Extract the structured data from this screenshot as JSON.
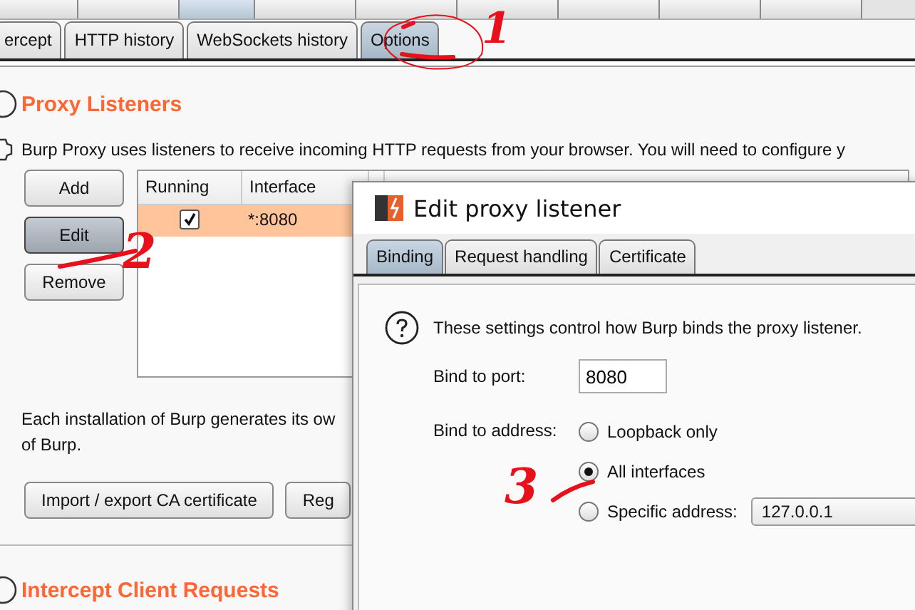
{
  "top_tabs": [
    {
      "selected": false
    },
    {
      "selected": false
    },
    {
      "selected": true
    },
    {
      "selected": false
    },
    {
      "selected": false
    },
    {
      "selected": false
    },
    {
      "selected": false
    },
    {
      "selected": false
    },
    {
      "selected": false
    }
  ],
  "sub_tabs": [
    {
      "label": "ercept",
      "selected": false
    },
    {
      "label": "HTTP history",
      "selected": false
    },
    {
      "label": "WebSockets history",
      "selected": false
    },
    {
      "label": "Options",
      "selected": true
    }
  ],
  "proxy_listeners": {
    "heading": "Proxy Listeners",
    "description": "Burp Proxy uses listeners to receive incoming HTTP requests from your browser. You will need to configure y",
    "buttons": [
      {
        "label": "Add",
        "pressed": false
      },
      {
        "label": "Edit",
        "pressed": true
      },
      {
        "label": "Remove",
        "pressed": false
      }
    ],
    "table": {
      "columns": [
        "Running",
        "Interface"
      ],
      "rows": [
        {
          "running": true,
          "interface": "*:8080",
          "selected": true
        }
      ]
    },
    "ca_text": [
      "Each installation of Burp generates its ow",
      "of Burp."
    ],
    "ca_buttons": [
      "Import / export CA certificate",
      "Reg"
    ]
  },
  "next_section": {
    "heading": "Intercept Client Requests"
  },
  "dialog": {
    "title": "Edit proxy listener",
    "tabs": [
      {
        "label": "Binding",
        "selected": true
      },
      {
        "label": "Request handling",
        "selected": false
      },
      {
        "label": "Certificate",
        "selected": false
      }
    ],
    "help_text": "These settings control how Burp binds the proxy listener.",
    "port_label": "Bind to port:",
    "port": "8080",
    "address_label": "Bind to address:",
    "address_options": [
      {
        "label": "Loopback only",
        "selected": false
      },
      {
        "label": "All interfaces",
        "selected": true
      },
      {
        "label": "Specific address:",
        "selected": false
      }
    ],
    "specific_address": "127.0.0.1"
  },
  "annotations": [
    "1",
    "2",
    "3"
  ]
}
